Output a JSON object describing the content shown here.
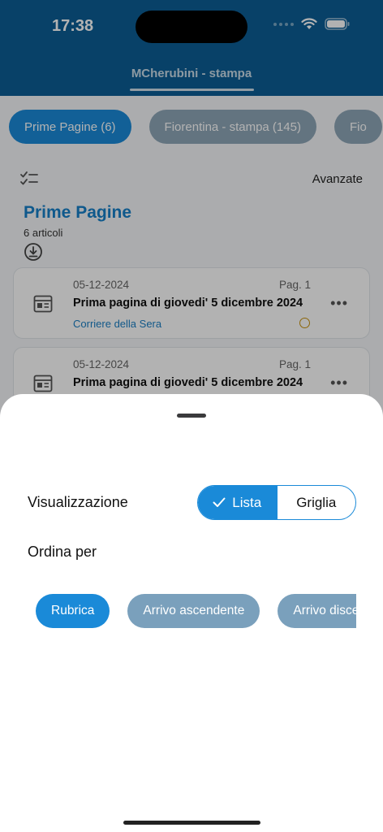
{
  "status_bar": {
    "time": "17:38"
  },
  "header": {
    "title": "MCherubini - stampa"
  },
  "filter_chips": [
    {
      "label": "Prime Pagine (6)",
      "active": true
    },
    {
      "label": "Fiorentina - stampa (145)",
      "active": false
    },
    {
      "label": "Fio",
      "active": false
    }
  ],
  "toolbar": {
    "advanced_label": "Avanzate"
  },
  "section": {
    "title": "Prime Pagine",
    "count": "6 articoli"
  },
  "articles": [
    {
      "date": "05-12-2024",
      "page": "Pag. 1",
      "title": "Prima pagina di giovedi' 5 dicembre 2024",
      "source": "Corriere della Sera"
    },
    {
      "date": "05-12-2024",
      "page": "Pag. 1",
      "title": "Prima pagina di giovedi' 5 dicembre 2024",
      "source": ""
    }
  ],
  "sheet": {
    "view_label": "Visualizzazione",
    "view_options": {
      "list": "Lista",
      "grid": "Griglia"
    },
    "sort_label": "Ordina per",
    "sort_options": [
      {
        "label": "Rubrica",
        "active": true
      },
      {
        "label": "Arrivo ascendente",
        "active": false
      },
      {
        "label": "Arrivo discendente",
        "active": false
      }
    ]
  },
  "colors": {
    "header": "#0c5e95",
    "accent": "#1a8ad8",
    "chip_inactive": "#7aa0bc"
  }
}
